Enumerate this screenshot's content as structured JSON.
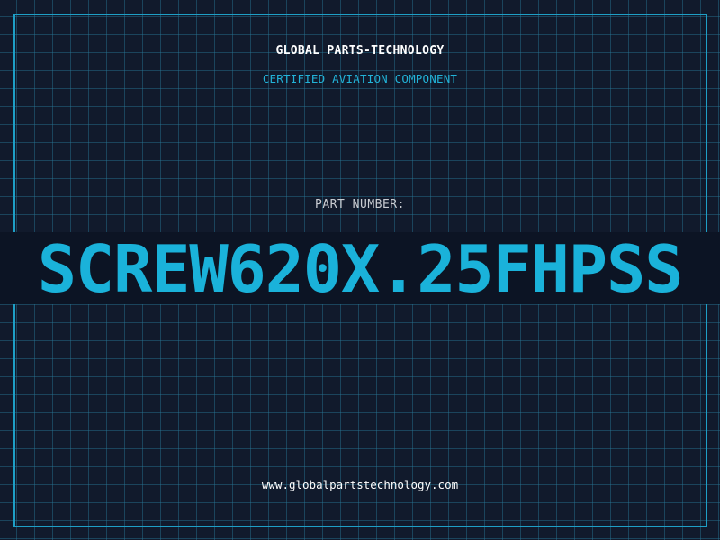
{
  "header": {
    "company": "GLOBAL PARTS-TECHNOLOGY",
    "subtitle": "CERTIFIED AVIATION COMPONENT"
  },
  "part": {
    "label": "PART NUMBER:",
    "number": "SCREW620X.25FHPSS"
  },
  "footer": {
    "website": "www.globalpartstechnology.com"
  },
  "colors": {
    "background": "#111a2c",
    "grid": "#1f5e74",
    "accent": "#1ab2da",
    "border": "#1e9fc6",
    "text_primary": "#ffffff",
    "text_muted": "#c9ccd2"
  }
}
